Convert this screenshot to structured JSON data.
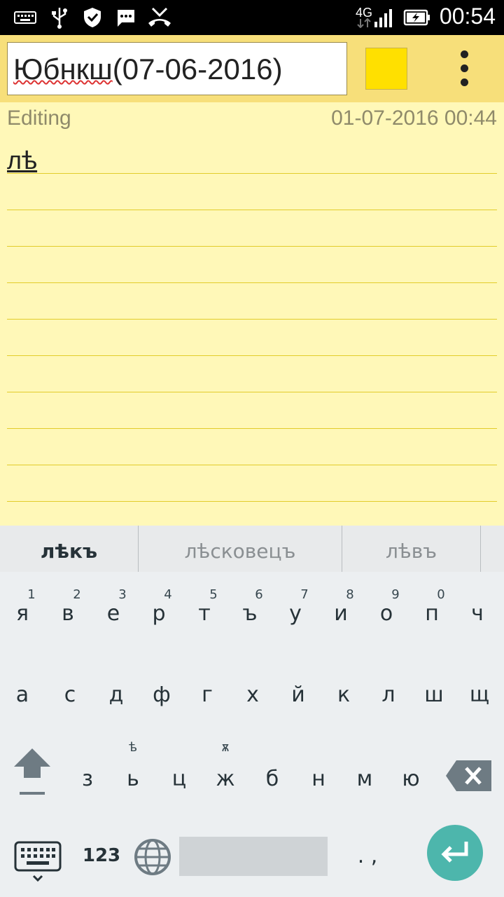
{
  "status_bar": {
    "network": "4G",
    "time": "00:54",
    "icons": [
      "keyboard-icon",
      "usb-icon",
      "shield-icon",
      "sms-icon",
      "missed-call-icon",
      "signal-icon",
      "battery-charging-icon"
    ]
  },
  "note": {
    "title": "Юбнкш(07-06-2016)",
    "title_misspelled": "Юбнкш",
    "title_rest": "(07-06-2016)",
    "color": "#ffe000",
    "status": "Editing",
    "timestamp": "01-07-2016 00:44",
    "body": "лѣ"
  },
  "suggestions": [
    "лѣкъ",
    "лѣсковецъ",
    "лѣвъ"
  ],
  "keyboard": {
    "row1": [
      {
        "key": "я",
        "hint": "1"
      },
      {
        "key": "в",
        "hint": "2"
      },
      {
        "key": "е",
        "hint": "3"
      },
      {
        "key": "р",
        "hint": "4"
      },
      {
        "key": "т",
        "hint": "5"
      },
      {
        "key": "ъ",
        "hint": "6"
      },
      {
        "key": "у",
        "hint": "7"
      },
      {
        "key": "и",
        "hint": "8"
      },
      {
        "key": "о",
        "hint": "9"
      },
      {
        "key": "п",
        "hint": "0"
      },
      {
        "key": "ч",
        "hint": ""
      }
    ],
    "row2": [
      "а",
      "с",
      "д",
      "ф",
      "г",
      "х",
      "й",
      "к",
      "л",
      "ш",
      "щ"
    ],
    "row3": [
      {
        "key": "з",
        "hint": ""
      },
      {
        "key": "ь",
        "hint": "ѣ"
      },
      {
        "key": "ц",
        "hint": ""
      },
      {
        "key": "ж",
        "hint": "ѫ"
      },
      {
        "key": "б",
        "hint": ""
      },
      {
        "key": "н",
        "hint": ""
      },
      {
        "key": "м",
        "hint": ""
      },
      {
        "key": "ю",
        "hint": ""
      }
    ],
    "numbers_label": "123",
    "punct_label": ". ,",
    "accent": "#4db6ac"
  }
}
